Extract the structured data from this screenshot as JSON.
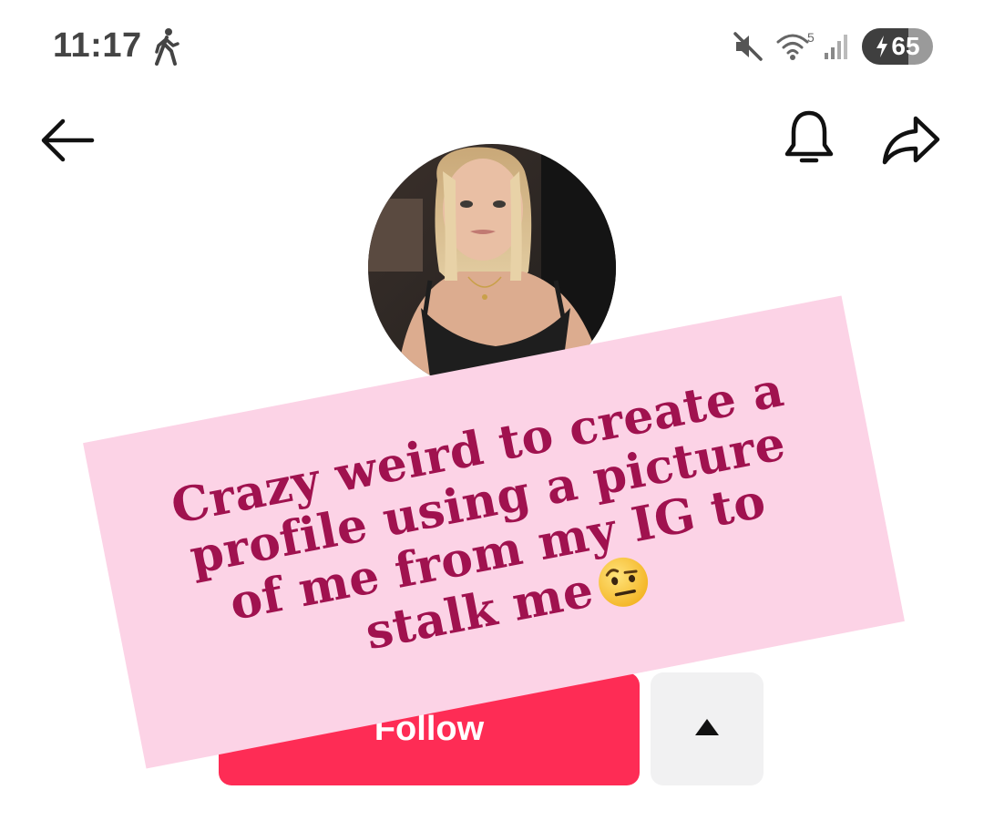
{
  "status_bar": {
    "time": "11:17",
    "wifi_label": "5",
    "battery_level": "65",
    "battery_fraction": 0.65,
    "icons": [
      "walking-icon",
      "mute-icon",
      "wifi-icon",
      "signal-icon",
      "battery-charging-icon"
    ]
  },
  "header": {
    "back_icon": "arrow-left-icon",
    "bell_icon": "bell-icon",
    "share_icon": "share-icon"
  },
  "profile": {
    "avatar_icon": "avatar"
  },
  "actions": {
    "follow_label": "Follow",
    "more_icon": "triangle-up-icon"
  },
  "caption": {
    "text": "Crazy weird to create a profile using a picture of me from my IG to stalk me",
    "emoji": "raised-eyebrow-emoji"
  },
  "colors": {
    "follow_button": "#fe2c55",
    "caption_background": "#fcd3e6",
    "caption_text": "#a0124f",
    "more_button": "#f1f1f2"
  }
}
